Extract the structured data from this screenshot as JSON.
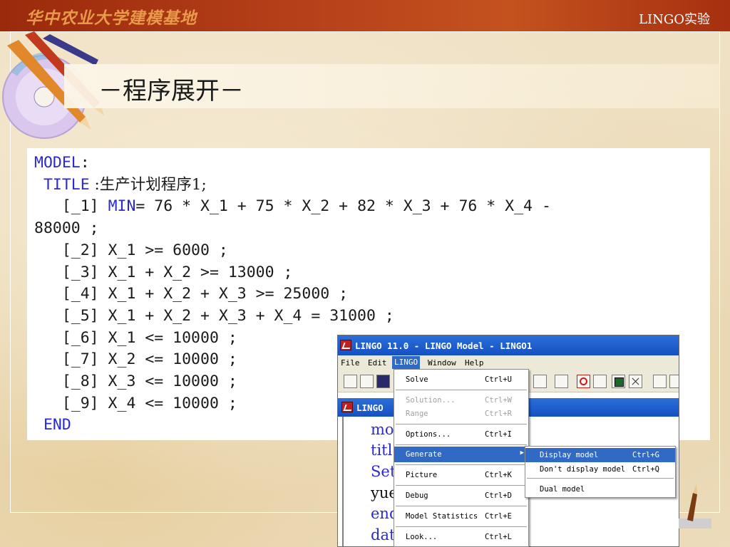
{
  "header": {
    "title": "华中农业大学建模基地",
    "right": "LINGO实验"
  },
  "slide": {
    "title": "－程序展开－"
  },
  "code": {
    "model_kw": "MODEL",
    "colon": ":",
    "title_kw": "TITLE",
    "title_text": " :生产计划程序1;",
    "l1_prefix": "   [_1] ",
    "min_kw": "MIN",
    "l1_rest": "= 76 * X_1 + 75 * X_2 + 82 * X_3 + 76 * X_4 -",
    "l1_cont": "88000 ;",
    "lines": [
      "   [_2] X_1 >= 6000 ;",
      "   [_3] X_1 + X_2 >= 13000 ;",
      "   [_4] X_1 + X_2 + X_3 >= 25000 ;",
      "   [_5] X_1 + X_2 + X_3 + X_4 = 31000 ;",
      "   [_6] X_1 <= 10000 ;",
      "   [_7] X_2 <= 10000 ;",
      "   [_8] X_3 <= 10000 ;",
      "   [_9] X_4 <= 10000 ;"
    ],
    "end_kw": "END"
  },
  "window": {
    "title": "LINGO 11.0 - LINGO Model - LINGO1",
    "menubar": [
      "File",
      "Edit",
      "LINGO",
      "Window",
      "Help"
    ],
    "active_menu": "LINGO",
    "sub_title": "LINGO",
    "editor_lines": [
      "mo",
      "titl",
      "Set",
      "yue",
      "end",
      "dat"
    ]
  },
  "menu": {
    "items": [
      {
        "label": "Solve",
        "shortcut": "Ctrl+U",
        "enabled": true
      },
      {
        "label": "Solution...",
        "shortcut": "Ctrl+W",
        "enabled": false
      },
      {
        "label": "Range",
        "shortcut": "Ctrl+R",
        "enabled": false
      },
      {
        "label": "Options...",
        "shortcut": "Ctrl+I",
        "enabled": true
      },
      {
        "label": "Generate",
        "shortcut": "",
        "enabled": true,
        "highlighted": true
      },
      {
        "label": "Picture",
        "shortcut": "Ctrl+K",
        "enabled": true
      },
      {
        "label": "Debug",
        "shortcut": "Ctrl+D",
        "enabled": true
      },
      {
        "label": "Model Statistics",
        "shortcut": "Ctrl+E",
        "enabled": true
      },
      {
        "label": "Look...",
        "shortcut": "Ctrl+L",
        "enabled": true
      }
    ]
  },
  "submenu": {
    "items": [
      {
        "label": "Display model",
        "shortcut": "Ctrl+G",
        "highlighted": true
      },
      {
        "label": "Don't display model",
        "shortcut": "Ctrl+Q"
      },
      {
        "label": "Dual model",
        "shortcut": ""
      }
    ]
  },
  "colors": {
    "header": "#b8421a",
    "keyword": "#2a2ad0",
    "menu_highlight": "#316ac5",
    "titlebar": "#1550c2"
  }
}
